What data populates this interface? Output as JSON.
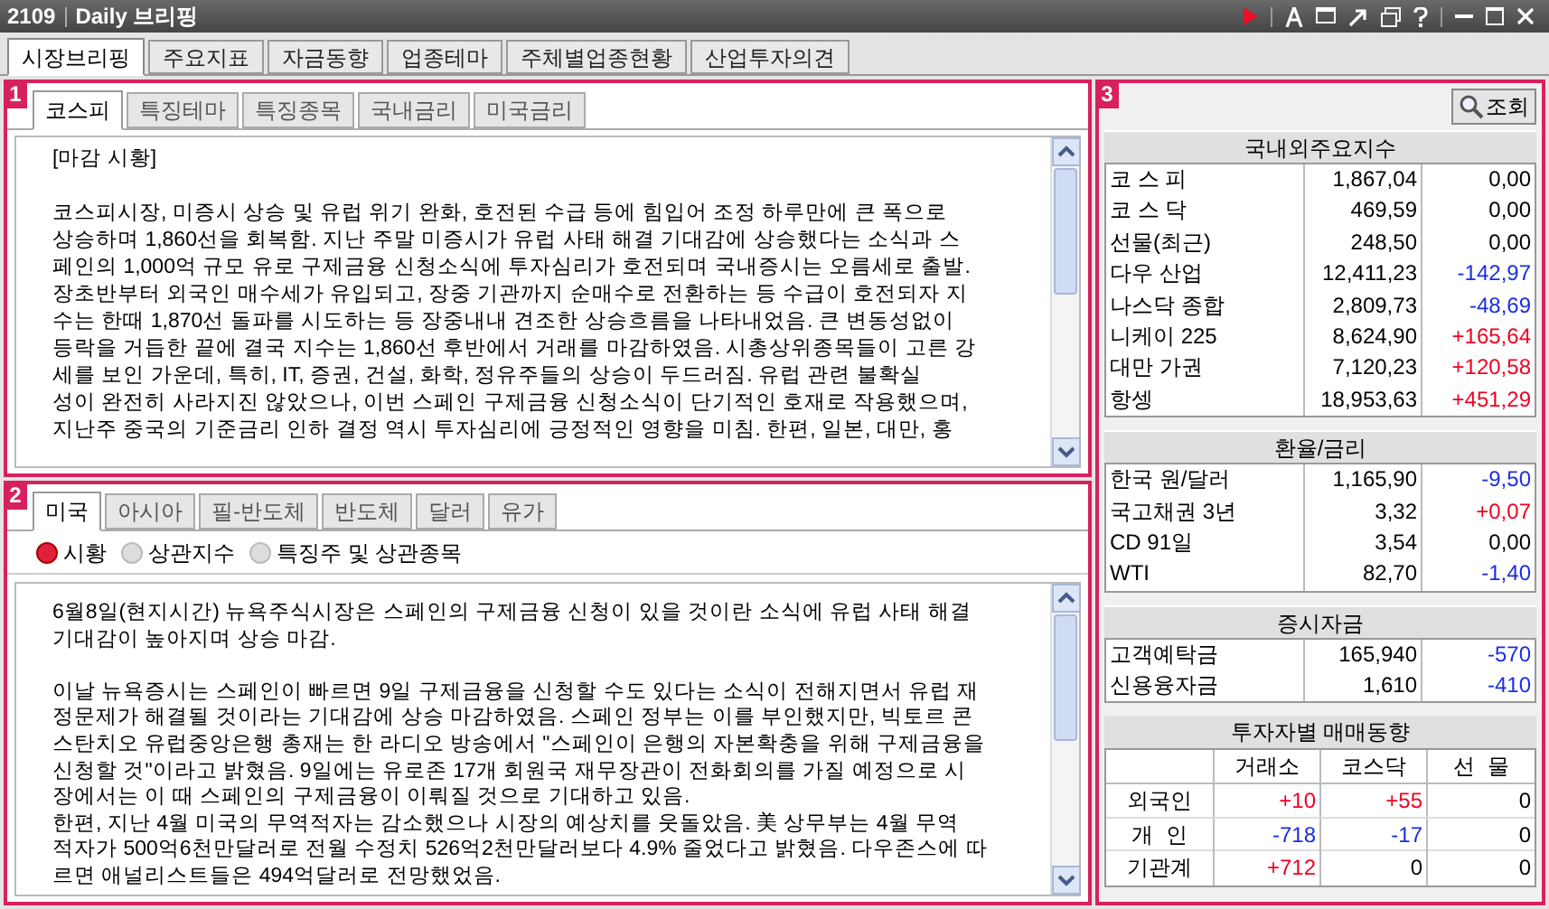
{
  "window": {
    "code": "2109",
    "title": "Daily 브리핑"
  },
  "main_tabs": [
    {
      "label": "시장브리핑",
      "selected": true
    },
    {
      "label": "주요지표",
      "selected": false
    },
    {
      "label": "자금동향",
      "selected": false
    },
    {
      "label": "업종테마",
      "selected": false
    },
    {
      "label": "주체별업종현황",
      "selected": false
    },
    {
      "label": "산업투자의견",
      "selected": false
    }
  ],
  "panel_1": {
    "badge": "1",
    "tabs": [
      {
        "label": "코스피",
        "selected": true
      },
      {
        "label": "특징테마",
        "selected": false
      },
      {
        "label": "특징종목",
        "selected": false
      },
      {
        "label": "국내금리",
        "selected": false
      },
      {
        "label": "미국금리",
        "selected": false
      }
    ],
    "heading": "[마감 시황]",
    "body": "코스피시장, 미증시 상승 및 유럽 위기 완화, 호전된 수급 등에 힘입어 조정 하루만에 큰 폭으로\n상승하며 1,860선을 회복함. 지난 주말 미증시가 유럽 사태 해결 기대감에 상승했다는 소식과 스\n페인의 1,000억 규모 유로 구제금융 신청소식에 투자심리가 호전되며 국내증시는 오름세로 출발.\n장초반부터 외국인 매수세가 유입되고, 장중 기관까지 순매수로 전환하는 등 수급이 호전되자 지\n수는 한때 1,870선 돌파를 시도하는 등 장중내내 견조한 상승흐름을 나타내었음. 큰 변동성없이\n등락을 거듭한 끝에 결국 지수는 1,860선 후반에서 거래를 마감하였음. 시총상위종목들이 고른 강\n세를 보인 가운데, 특히, IT, 증권, 건설, 화학, 정유주들의 상승이 두드러짐. 유럽 관련 불확실\n성이 완전히 사라지진 않았으나, 이번 스페인 구제금융 신청소식이 단기적인 호재로 작용했으며,\n지난주 중국의 기준금리 인하 결정 역시 투자심리에 긍정적인 영향을 미침. 한편, 일본, 대만, 홍"
  },
  "panel_2": {
    "badge": "2",
    "tabs": [
      {
        "label": "미국",
        "selected": true
      },
      {
        "label": "아시아",
        "selected": false
      },
      {
        "label": "필-반도체",
        "selected": false
      },
      {
        "label": "반도체",
        "selected": false
      },
      {
        "label": "달러",
        "selected": false
      },
      {
        "label": "유가",
        "selected": false
      }
    ],
    "radios": [
      {
        "label": "시황",
        "selected": true
      },
      {
        "label": "상관지수",
        "selected": false
      },
      {
        "label": "특징주 및 상관종목",
        "selected": false
      }
    ],
    "body": "6월8일(현지시간) 뉴욕주식시장은 스페인의 구제금융 신청이 있을 것이란 소식에 유럽 사태 해결\n기대감이 높아지며 상승 마감.\n\n이날 뉴욕증시는 스페인이 빠르면 9일 구제금융을 신청할 수도 있다는 소식이 전해지면서 유럽 재\n정문제가 해결될 것이라는 기대감에 상승 마감하였음. 스페인 정부는 이를 부인했지만, 빅토르 콘\n스탄치오 유럽중앙은행 총재는 한 라디오 방송에서 \"스페인이 은행의 자본확충을 위해 구제금융을\n신청할 것\"이라고 밝혔음. 9일에는 유로존 17개 회원국 재무장관이 전화회의를 가질 예정으로 시\n장에서는 이 때 스페인의 구제금융이 이뤄질 것으로 기대하고 있음.\n한편, 지난 4월 미국의 무역적자는 감소했으나 시장의 예상치를 웃돌았음. 美 상무부는 4월 무역\n적자가 500억6천만달러로 전월 수정치 526억2천만달러보다 4.9% 줄었다고 밝혔음. 다우존스에 따\n르면 애널리스트들은 494억달러로 전망했었음."
  },
  "panel_3": {
    "badge": "3",
    "search_button": "조회",
    "tables": [
      {
        "title": "국내외주요지수",
        "rows": [
          {
            "name": "코 스 피",
            "value": "1,867,04",
            "change": "0,00",
            "color": "#000000"
          },
          {
            "name": "코 스 닥",
            "value": "469,59",
            "change": "0,00",
            "color": "#000000"
          },
          {
            "name": "선물(최근)",
            "value": "248,50",
            "change": "0,00",
            "color": "#000000"
          },
          {
            "name": "다우 산업",
            "value": "12,411,23",
            "change": "-142,97",
            "color": "#1a2ee0"
          },
          {
            "name": "나스닥 종합",
            "value": "2,809,73",
            "change": "-48,69",
            "color": "#1a2ee0"
          },
          {
            "name": "니케이 225",
            "value": "8,624,90",
            "change": "+165,64",
            "color": "#f00020"
          },
          {
            "name": "대만 가권",
            "value": "7,120,23",
            "change": "+120,58",
            "color": "#f00020"
          },
          {
            "name": "항셍",
            "value": "18,953,63",
            "change": "+451,29",
            "color": "#f00020"
          }
        ]
      },
      {
        "title": "환율/금리",
        "rows": [
          {
            "name": "한국 원/달러",
            "value": "1,165,90",
            "change": "-9,50",
            "color": "#1a2ee0"
          },
          {
            "name": "국고채권 3년",
            "value": "3,32",
            "change": "+0,07",
            "color": "#f00020"
          },
          {
            "name": "CD 91일",
            "value": "3,54",
            "change": "0,00",
            "color": "#000000"
          },
          {
            "name": "WTI",
            "value": "82,70",
            "change": "-1,40",
            "color": "#1a2ee0"
          }
        ]
      },
      {
        "title": "증시자금",
        "rows": [
          {
            "name": "고객예탁금",
            "value": "165,940",
            "change": "-570",
            "color": "#1a2ee0"
          },
          {
            "name": "신용융자금",
            "value": "1,610",
            "change": "-410",
            "color": "#1a2ee0"
          }
        ]
      }
    ],
    "investors": {
      "title": "투자자별 매매동향",
      "columns": [
        "거래소",
        "코스닥",
        "선  물"
      ],
      "rows": [
        {
          "name": "외국인",
          "cells": [
            {
              "text": "+10",
              "color": "#f00020"
            },
            {
              "text": "+55",
              "color": "#f00020"
            },
            {
              "text": "0",
              "color": "#000000"
            }
          ]
        },
        {
          "name": "개  인",
          "cells": [
            {
              "text": "-718",
              "color": "#1a2ee0"
            },
            {
              "text": "-17",
              "color": "#1a2ee0"
            },
            {
              "text": "0",
              "color": "#000000"
            }
          ]
        },
        {
          "name": "기관계",
          "cells": [
            {
              "text": "+712",
              "color": "#f00020"
            },
            {
              "text": "0",
              "color": "#000000"
            },
            {
              "text": "0",
              "color": "#000000"
            }
          ]
        }
      ]
    }
  }
}
